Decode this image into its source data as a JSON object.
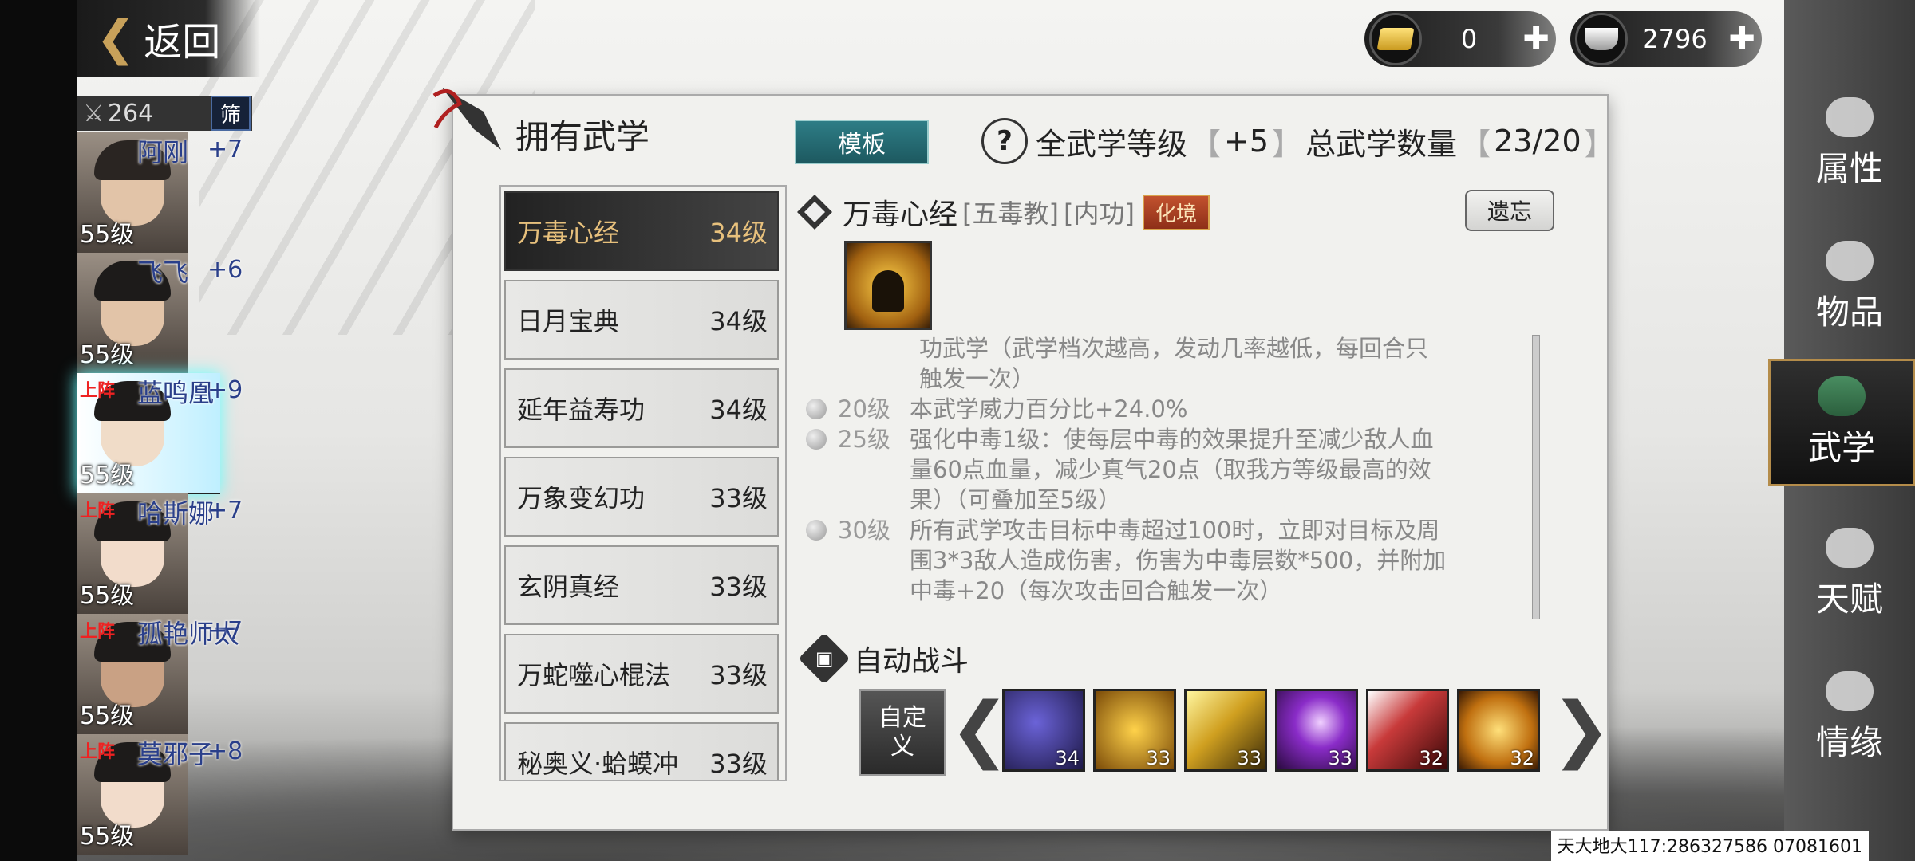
{
  "back_label": "返回",
  "currency": {
    "gold": "0",
    "silver": "2796"
  },
  "team": {
    "count": "264",
    "filter_label": "筛",
    "members": [
      {
        "name": "阿刚",
        "plus": "+7",
        "level": "55级",
        "tag": ""
      },
      {
        "name": "飞飞",
        "plus": "+6",
        "level": "55级",
        "tag": ""
      },
      {
        "name": "蓝鸣凰",
        "plus": "+9",
        "level": "55级",
        "tag": "上阵"
      },
      {
        "name": "哈斯娜",
        "plus": "+7",
        "level": "55级",
        "tag": "上阵"
      },
      {
        "name": "孤艳师太",
        "plus": "+7",
        "level": "55级",
        "tag": "上阵"
      },
      {
        "name": "莫邪子",
        "plus": "+8",
        "level": "55级",
        "tag": "上阵"
      }
    ]
  },
  "panel": {
    "title": "拥有武学",
    "template_btn": "模板",
    "all_level_label": "全武学等级",
    "all_level_val": "+5",
    "total_label": "总武学数量",
    "total_val": "23/20",
    "skills": [
      {
        "name": "万毒心经",
        "level": "34级"
      },
      {
        "name": "日月宝典",
        "level": "34级"
      },
      {
        "name": "延年益寿功",
        "level": "34级"
      },
      {
        "name": "万象变幻功",
        "level": "33级"
      },
      {
        "name": "玄阴真经",
        "level": "33级"
      },
      {
        "name": "万蛇噬心棍法",
        "level": "33级"
      },
      {
        "name": "秘奥义·蛤蟆冲",
        "level": "33级"
      }
    ],
    "detail": {
      "name": "万毒心经",
      "sect": "[五毒教]",
      "type": "[内功]",
      "realm": "化境",
      "forget": "遗忘",
      "intro_1": "功武学（武学档次越高，发动几率越低，每回合只",
      "intro_2": "触发一次）",
      "effects": [
        {
          "lvl": "20级",
          "lines": [
            "本武学威力百分比+24.0%"
          ]
        },
        {
          "lvl": "25级",
          "lines": [
            "强化中毒1级：使每层中毒的效果提升至减少敌人血",
            "量60点血量，减少真气20点（取我方等级最高的效",
            "果）（可叠加至5级）"
          ]
        },
        {
          "lvl": "30级",
          "lines": [
            "所有武学攻击目标中毒超过100时，立即对目标及周",
            "围3*3敌人造成伤害，伤害为中毒层数*500，并附加",
            "中毒+20（每次攻击回合触发一次）"
          ]
        }
      ]
    },
    "auto": {
      "title": "自动战斗",
      "custom_btn": "自定义",
      "slots": [
        "34",
        "33",
        "33",
        "33",
        "32",
        "32"
      ]
    }
  },
  "nav": [
    {
      "label": "属性",
      "icon": "attribute-icon"
    },
    {
      "label": "物品",
      "icon": "item-icon"
    },
    {
      "label": "武学",
      "icon": "martial-icon"
    },
    {
      "label": "天赋",
      "icon": "talent-icon"
    },
    {
      "label": "情缘",
      "icon": "affinity-icon"
    }
  ],
  "footer_id": "天大地大117:286327586 07081601"
}
